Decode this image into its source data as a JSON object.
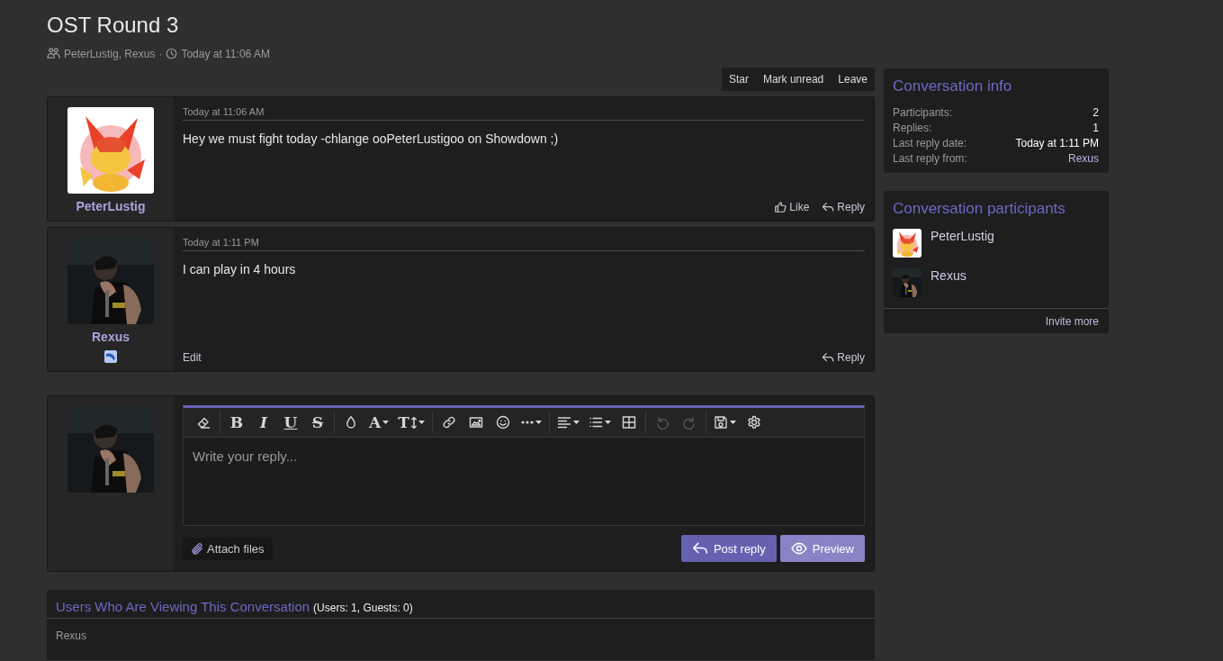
{
  "thread": {
    "title": "OST Round 3",
    "participants": "PeterLustig, Rexus",
    "separator": "·",
    "started": "Today at 11:06 AM"
  },
  "actions": [
    "Star",
    "Mark unread",
    "Leave"
  ],
  "messages": [
    {
      "author": "PeterLustig",
      "badge": false,
      "date": "Today at 11:06 AM",
      "text": "Hey we must fight today -chlange ooPeterLustigoo on Showdown ;)",
      "actions": [
        {
          "kind": "like",
          "label": "Like"
        },
        {
          "kind": "reply",
          "label": "Reply"
        }
      ]
    },
    {
      "author": "Rexus",
      "badge": true,
      "date": "Today at 1:11 PM",
      "text": "I can play in 4 hours",
      "actions": [
        {
          "kind": "edit",
          "label": "Edit"
        },
        {
          "kind": "reply",
          "label": "Reply"
        }
      ]
    }
  ],
  "editor": {
    "glyphs": [
      "B",
      "I",
      "U",
      "S",
      "A",
      "T"
    ],
    "undo_disabled": true,
    "redo_disabled": true,
    "placeholder": "Write your reply...",
    "attach": "Attach files",
    "post": "Post reply",
    "preview": "Preview"
  },
  "viewers": {
    "title": "Users Who Are Viewing This Conversation",
    "counts": "(Users: 1, Guests: 0)",
    "users": [
      "Rexus"
    ]
  },
  "sidebar": {
    "info": {
      "title": "Conversation info",
      "rows": [
        {
          "label": "Participants:",
          "value": "2",
          "kind": "plain"
        },
        {
          "label": "Replies:",
          "value": "1",
          "kind": "plain"
        },
        {
          "label": "Last reply date:",
          "value": "Today at 1:11 PM",
          "kind": "time"
        },
        {
          "label": "Last reply from:",
          "value": "Rexus",
          "kind": "link"
        }
      ]
    },
    "participants": {
      "title": "Conversation participants",
      "users": [
        "PeterLustig",
        "Rexus"
      ],
      "invite": "Invite more"
    }
  }
}
